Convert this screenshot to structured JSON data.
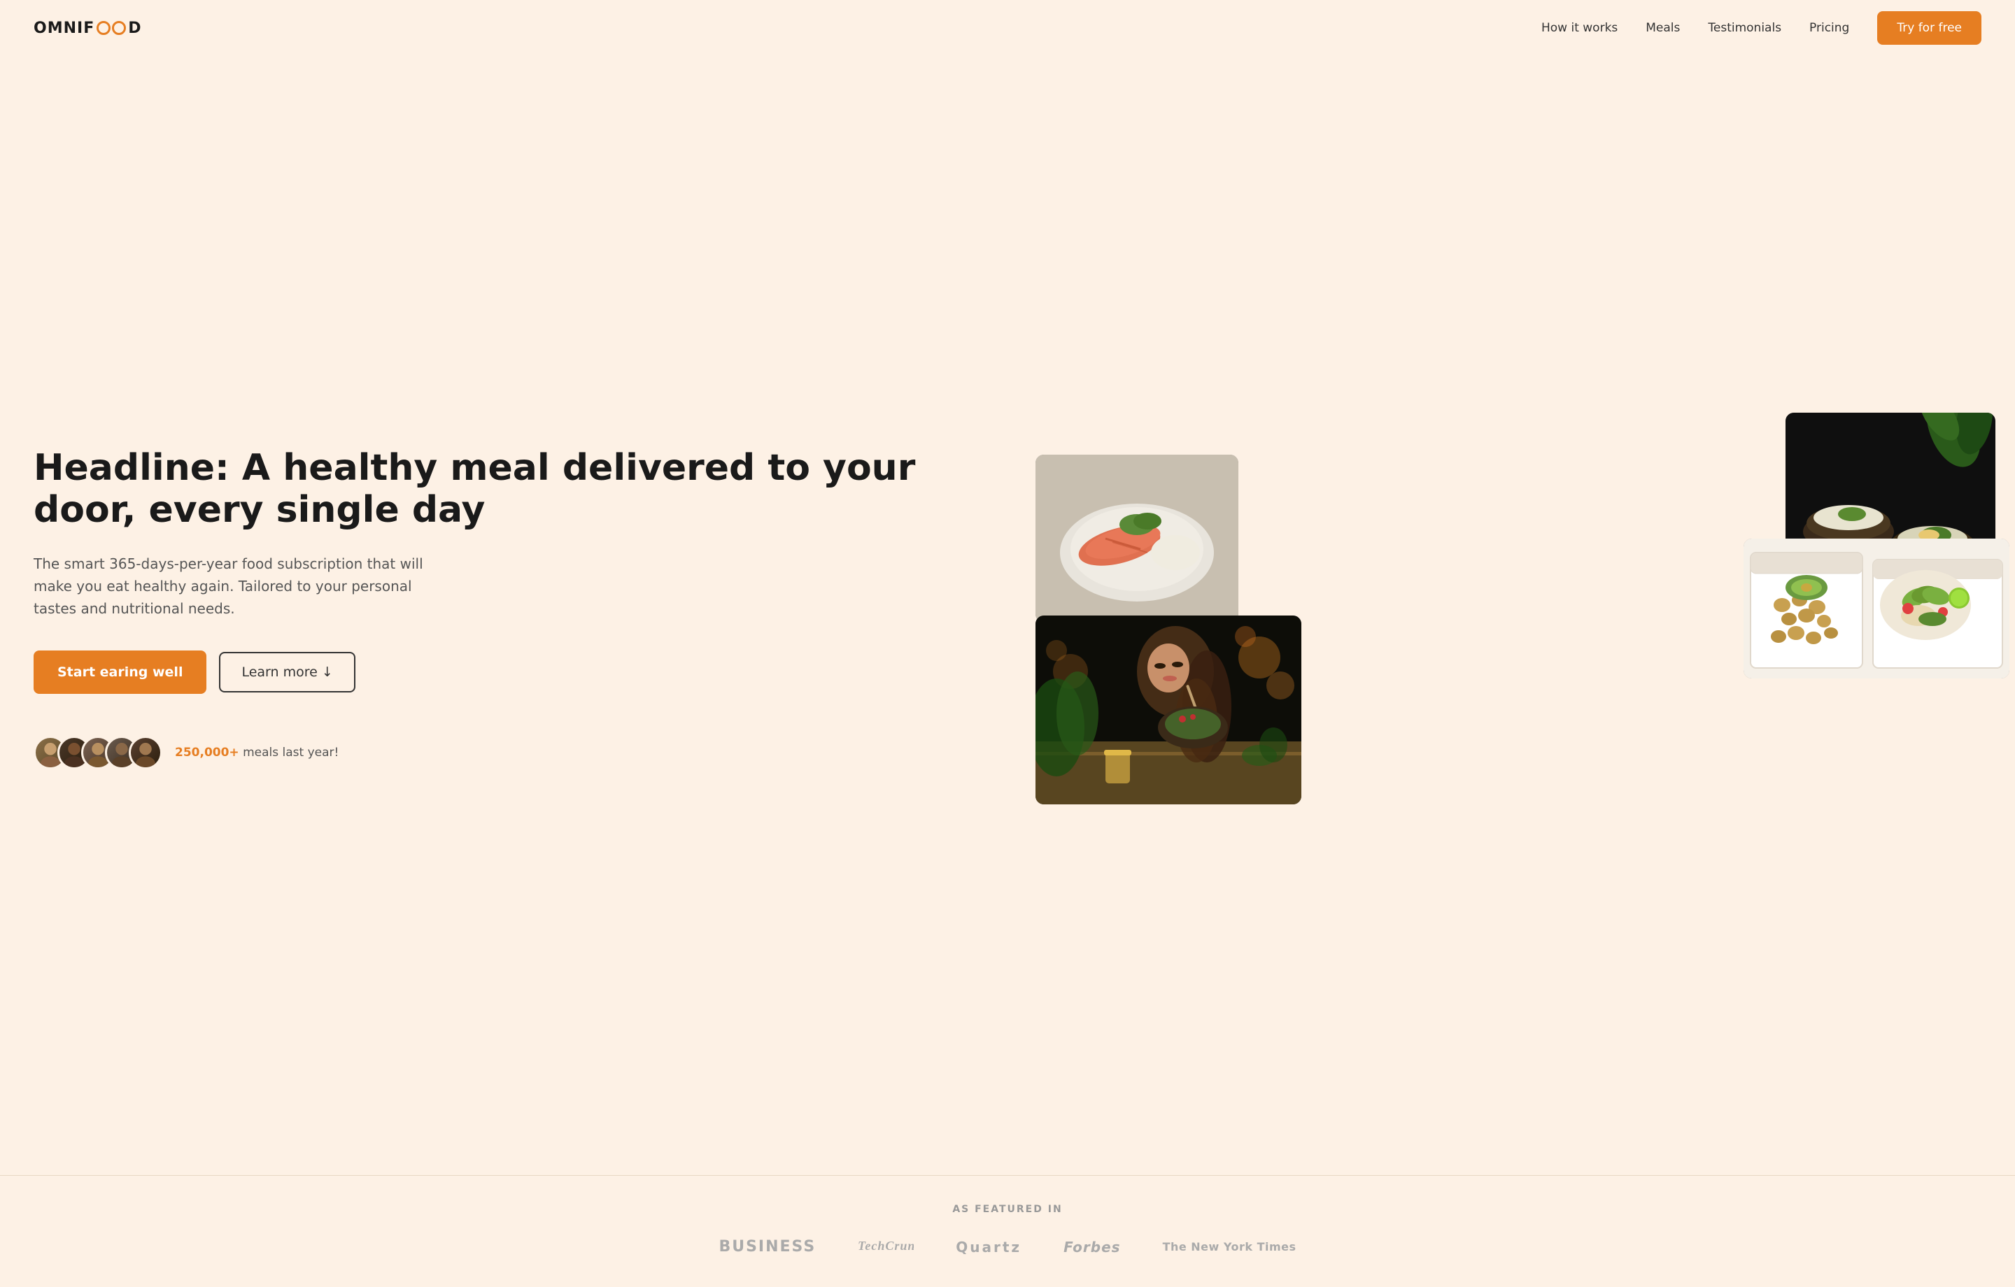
{
  "logo": {
    "text_before": "OMNIF",
    "text_after": "D",
    "brand_color": "#e67e22"
  },
  "navbar": {
    "links": [
      {
        "id": "how-it-works",
        "label": "How it works",
        "href": "#"
      },
      {
        "id": "meals",
        "label": "Meals",
        "href": "#"
      },
      {
        "id": "testimonials",
        "label": "Testimonials",
        "href": "#"
      },
      {
        "id": "pricing",
        "label": "Pricing",
        "href": "#"
      }
    ],
    "cta": {
      "label": "Try for free",
      "href": "#"
    }
  },
  "hero": {
    "title": "Headline: A healthy meal delivered to your door, every single day",
    "description": "The smart 365-days-per-year food subscription that will make you eat healthy again. Tailored to your personal tastes and nutritional needs.",
    "btn_primary": "Start earing well",
    "btn_secondary": "Learn more ↓",
    "social_proof": {
      "count": "250,000+",
      "text": " meals last year!",
      "avatars": [
        {
          "id": "av1",
          "emoji": "👩"
        },
        {
          "id": "av2",
          "emoji": "👨"
        },
        {
          "id": "av3",
          "emoji": "👩"
        },
        {
          "id": "av4",
          "emoji": "👨"
        },
        {
          "id": "av5",
          "emoji": "👩"
        }
      ]
    }
  },
  "featured": {
    "label": "AS FEATURED IN",
    "logos": [
      "BUSINESS",
      "TechCrunch",
      "Quartz",
      "Forbes",
      "The New York Times"
    ]
  }
}
